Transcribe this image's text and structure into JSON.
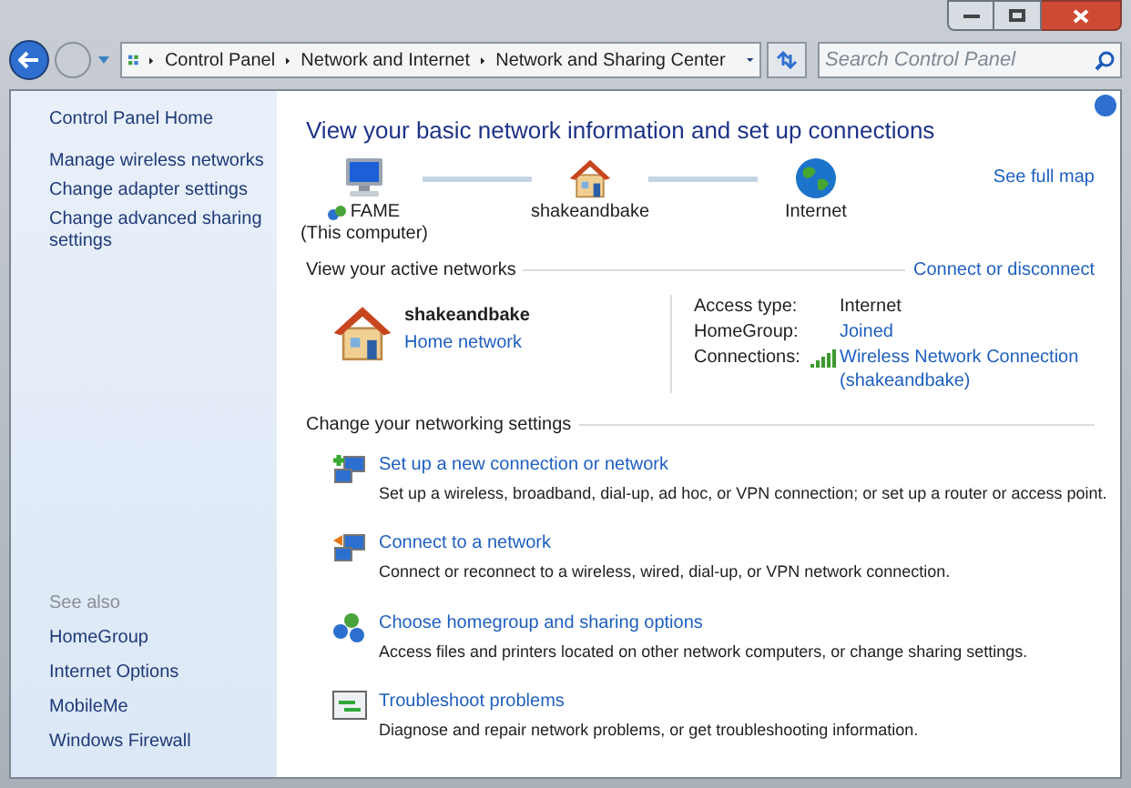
{
  "address_bar": {
    "breadcrumbs": [
      "Control Panel",
      "Network and Internet",
      "Network and Sharing Center"
    ]
  },
  "search": {
    "placeholder": "Search Control Panel"
  },
  "sidebar": {
    "items": [
      "Control Panel Home",
      "Manage wireless networks",
      "Change adapter settings",
      "Change advanced sharing settings"
    ],
    "see_also_title": "See also",
    "see_also": [
      "HomeGroup",
      "Internet Options",
      "MobileMe",
      "Windows Firewall"
    ]
  },
  "main": {
    "title": "View your basic network information and set up connections",
    "map": {
      "nodes": [
        {
          "kind": "computer",
          "label": "FAME",
          "sublabel": "(This computer)"
        },
        {
          "kind": "house",
          "label": "shakeandbake"
        },
        {
          "kind": "globe",
          "label": "Internet"
        }
      ],
      "link": "See full map"
    },
    "active_networks": {
      "heading": "View your active networks",
      "action": "Connect or disconnect",
      "network": {
        "name": "shakeandbake",
        "type": "Home network"
      },
      "details": [
        {
          "kind": "text",
          "label": "Access type:",
          "value": "Internet"
        },
        {
          "kind": "link",
          "label": "HomeGroup:",
          "value": "Joined"
        },
        {
          "kind": "wifi",
          "label": "Connections:",
          "value": "Wireless Network Connection (shakeandbake)"
        }
      ]
    },
    "settings": {
      "heading": "Change your networking settings",
      "tasks": [
        {
          "kind": "new",
          "title": "Set up a new connection or network",
          "description": "Set up a wireless, broadband, dial-up, ad hoc, or VPN connection; or set up a router or access point."
        },
        {
          "kind": "connect",
          "title": "Connect to a network",
          "description": "Connect or reconnect to a wireless, wired, dial-up, or VPN network connection."
        },
        {
          "kind": "homegroup",
          "title": "Choose homegroup and sharing options",
          "description": "Access files and printers located on other network computers, or change sharing settings."
        },
        {
          "kind": "troubleshoot",
          "title": "Troubleshoot problems",
          "description": "Diagnose and repair network problems, or get troubleshooting information."
        }
      ]
    }
  }
}
